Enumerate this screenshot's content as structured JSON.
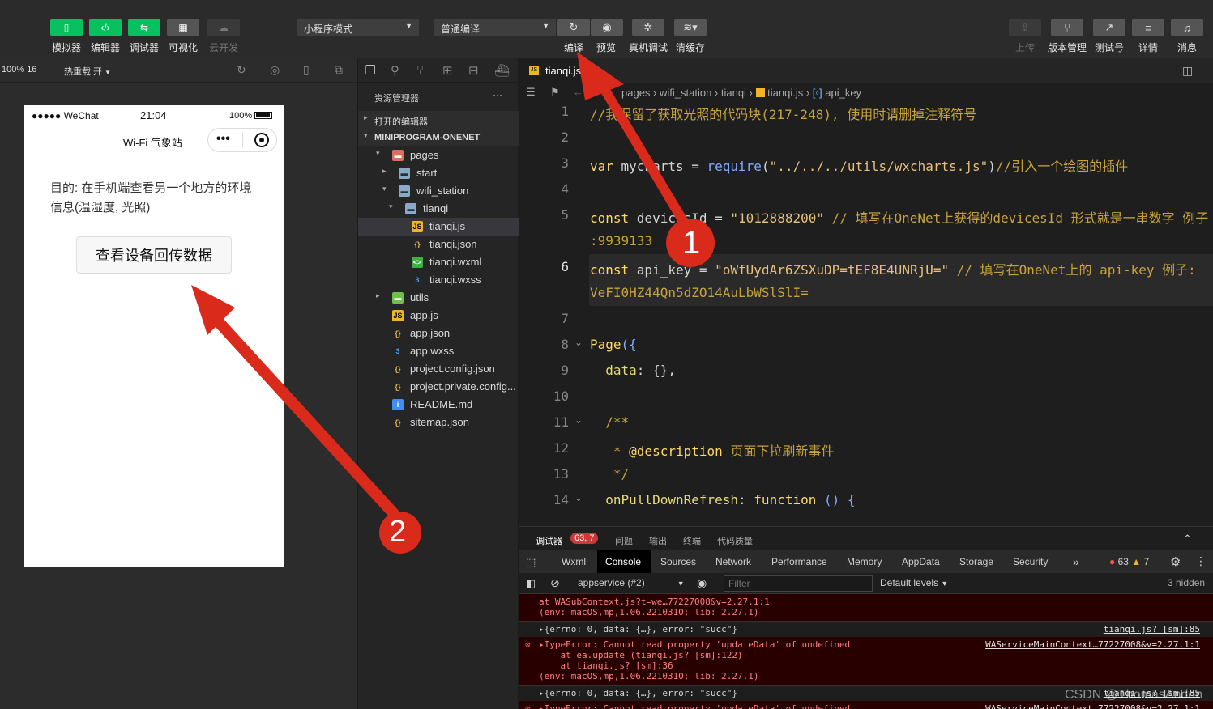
{
  "toolbar": {
    "left_buttons": [
      {
        "label": "模拟器",
        "icon": "phone-icon",
        "color": "#07c160"
      },
      {
        "label": "编辑器",
        "icon": "code-icon",
        "color": "#07c160"
      },
      {
        "label": "调试器",
        "icon": "debug-icon",
        "color": "#07c160"
      },
      {
        "label": "可视化",
        "icon": "layout-icon",
        "color": "#555555"
      },
      {
        "label": "云开发",
        "icon": "cloud-icon",
        "color": "#3a3a3a"
      }
    ],
    "mode_select": "小程序模式",
    "compile_select": "普通编译",
    "mid_buttons": [
      {
        "label": "编译",
        "icon": "refresh-icon"
      },
      {
        "label": "预览",
        "icon": "eye-icon"
      },
      {
        "label": "真机调试",
        "icon": "bug-icon"
      },
      {
        "label": "清缓存",
        "icon": "layers-icon"
      }
    ],
    "right_buttons": [
      {
        "label": "上传",
        "icon": "upload-icon"
      },
      {
        "label": "版本管理",
        "icon": "branch-icon"
      },
      {
        "label": "测试号",
        "icon": "external-icon"
      },
      {
        "label": "详情",
        "icon": "menu-icon"
      },
      {
        "label": "消息",
        "icon": "bell-icon"
      }
    ]
  },
  "simulator": {
    "zoom": "100% 16",
    "hot_reload": "热重载 开",
    "status_bar": {
      "carrier": "●●●●● WeChat",
      "time": "21:04",
      "battery": "100%"
    },
    "nav_title": "Wi-Fi 气象站",
    "purpose_text": "目的: 在手机端查看另一个地方的环境信息(温湿度, 光照)",
    "button_label": "查看设备回传数据"
  },
  "explorer": {
    "title": "资源管理器",
    "more": "···",
    "open_editors": "打开的编辑器",
    "project": "MINIPROGRAM-ONENET",
    "tree": [
      {
        "name": "pages",
        "depth": 1,
        "type": "folder-red",
        "arrow": "▾"
      },
      {
        "name": "start",
        "depth": 2,
        "type": "folder",
        "arrow": "▸"
      },
      {
        "name": "wifi_station",
        "depth": 2,
        "type": "folder",
        "arrow": "▾"
      },
      {
        "name": "tianqi",
        "depth": 3,
        "type": "folder",
        "arrow": "▾"
      },
      {
        "name": "tianqi.js",
        "depth": 4,
        "type": "js",
        "arrow": "",
        "active": true
      },
      {
        "name": "tianqi.json",
        "depth": 4,
        "type": "json",
        "arrow": ""
      },
      {
        "name": "tianqi.wxml",
        "depth": 4,
        "type": "wxml",
        "arrow": ""
      },
      {
        "name": "tianqi.wxss",
        "depth": 4,
        "type": "wxss",
        "arrow": ""
      },
      {
        "name": "utils",
        "depth": 1,
        "type": "folder-green",
        "arrow": "▸"
      },
      {
        "name": "app.js",
        "depth": 1,
        "type": "js",
        "arrow": ""
      },
      {
        "name": "app.json",
        "depth": 1,
        "type": "json",
        "arrow": ""
      },
      {
        "name": "app.wxss",
        "depth": 1,
        "type": "wxss",
        "arrow": ""
      },
      {
        "name": "project.config.json",
        "depth": 1,
        "type": "json",
        "arrow": ""
      },
      {
        "name": "project.private.config...",
        "depth": 1,
        "type": "json",
        "arrow": ""
      },
      {
        "name": "README.md",
        "depth": 1,
        "type": "info",
        "arrow": ""
      },
      {
        "name": "sitemap.json",
        "depth": 1,
        "type": "json",
        "arrow": ""
      }
    ]
  },
  "editor": {
    "tab": "tianqi.js",
    "breadcrumb": [
      "pages",
      "wifi_station",
      "tianqi",
      "tianqi.js",
      "api_key"
    ],
    "line_numbers": [
      "1",
      "2",
      "3",
      "4",
      "5",
      "",
      "6",
      "",
      "7",
      "8",
      "9",
      "10",
      "11",
      "12",
      "13",
      "14"
    ],
    "code": [
      [
        {
          "t": "//我保留了获取光照的代码块(217-248), 使用时请删掉注释符号",
          "c": "cm"
        }
      ],
      [],
      [
        {
          "t": "var ",
          "c": "kw"
        },
        {
          "t": "mycharts = "
        },
        {
          "t": "require",
          "c": "fn"
        },
        {
          "t": "("
        },
        {
          "t": "\"../../../utils/wxcharts.js\"",
          "c": "st"
        },
        {
          "t": ")"
        },
        {
          "t": "//引入一个绘图的插件",
          "c": "cm"
        }
      ],
      [],
      [
        {
          "t": "const ",
          "c": "kw"
        },
        {
          "t": "devicesId = "
        },
        {
          "t": "\"1012888200\"",
          "c": "st"
        },
        {
          "t": " // 填写在OneNet上获得的devicesId 形式就是一串数字 例子",
          "c": "cm"
        }
      ],
      [
        {
          "t": ":9939133",
          "c": "cm"
        }
      ],
      [
        {
          "t": "const ",
          "c": "kw"
        },
        {
          "t": "api_key = "
        },
        {
          "t": "\"oWfUydAr6ZSXuDP=tEF8E4UNRjU=\"",
          "c": "st"
        },
        {
          "t": " // 填写在OneNet上的 api-key 例子:",
          "c": "cm"
        }
      ],
      [
        {
          "t": "VeFI0HZ44Qn5dZO14AuLbWSlSlI=",
          "c": "cm"
        }
      ],
      [],
      [
        {
          "t": "Page",
          "c": "kw"
        },
        {
          "t": "({",
          "c": "fn"
        }
      ],
      [
        {
          "t": "  data",
          "c": "pn"
        },
        {
          "t": ": {},"
        }
      ],
      [],
      [
        {
          "t": "  /**",
          "c": "cm"
        }
      ],
      [
        {
          "t": "   * ",
          "c": "cm"
        },
        {
          "t": "@description",
          "c": "kw"
        },
        {
          "t": " 页面下拉刷新事件",
          "c": "cm"
        }
      ],
      [
        {
          "t": "   */",
          "c": "cm"
        }
      ],
      [
        {
          "t": "  onPullDownRefresh",
          "c": "pn"
        },
        {
          "t": ": "
        },
        {
          "t": "function",
          "c": "kw"
        },
        {
          "t": " () {",
          "c": "fn"
        }
      ]
    ]
  },
  "console": {
    "top_tabs": [
      "调试器",
      "问题",
      "输出",
      "终端",
      "代码质量"
    ],
    "badge": "63, 7",
    "tabs": [
      "Wxml",
      "Console",
      "Sources",
      "Network",
      "Performance",
      "Memory",
      "AppData",
      "Storage",
      "Security"
    ],
    "more_tabs": "»",
    "error_count": "63",
    "warn_count": "7",
    "context": "appservice (#2)",
    "filter_placeholder": "Filter",
    "levels": "Default levels",
    "hidden": "3 hidden",
    "logs": [
      {
        "kind": "err",
        "lines": [
          "at WASubContext.js?t=we…77227008&v=2.27.1:1",
          "(env: macOS,mp,1.06.2210310; lib: 2.27.1)"
        ],
        "link": ""
      },
      {
        "kind": "ok",
        "lines": [
          "▸{errno: 0, data: {…}, error: \"succ\"}"
        ],
        "link": "tianqi.js? [sm]:85"
      },
      {
        "kind": "err",
        "lines": [
          "▸TypeError: Cannot read property 'updateData' of undefined",
          "    at ea.update (tianqi.js? [sm]:122)",
          "    at tianqi.js? [sm]:36",
          "(env: macOS,mp,1.06.2210310; lib: 2.27.1)"
        ],
        "link": "WAServiceMainContext…77227008&v=2.27.1:1"
      },
      {
        "kind": "ok",
        "lines": [
          "▸{errno: 0, data: {…}, error: \"succ\"}"
        ],
        "link": "tianqi.js? [sm]:85"
      },
      {
        "kind": "err",
        "lines": [
          "▸TypeError: Cannot read property 'updateData' of undefined"
        ],
        "link": "WAServiceMainContext…77227008&v=2.27.1:1"
      }
    ]
  },
  "annotations": {
    "marker1": "1",
    "marker2": "2",
    "watermark": "CSDN @ThomasAndon",
    "arrow_color": "#d92a1c"
  }
}
